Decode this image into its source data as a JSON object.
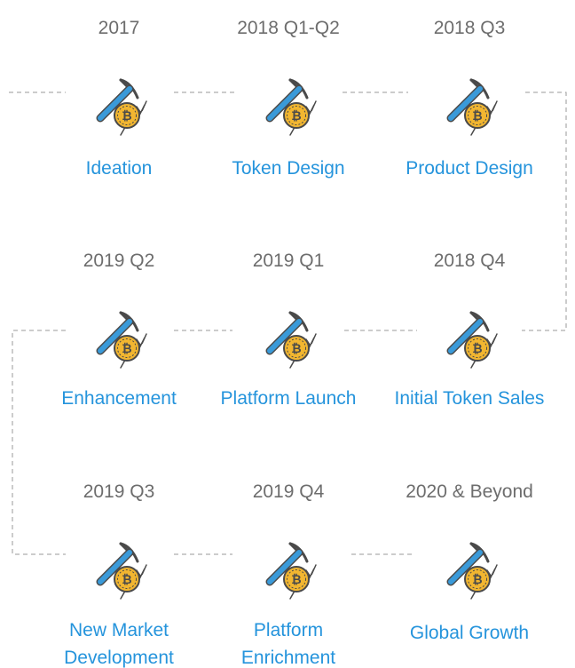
{
  "roadmap": {
    "milestones": [
      {
        "date": "2017",
        "label": "Ideation"
      },
      {
        "date": "2018 Q1-Q2",
        "label": "Token Design"
      },
      {
        "date": "2018 Q3",
        "label": "Product Design"
      },
      {
        "date": "2018 Q4",
        "label": "Initial Token Sales"
      },
      {
        "date": "2019 Q1",
        "label": "Platform Launch"
      },
      {
        "date": "2019 Q2",
        "label": "Enhancement"
      },
      {
        "date": "2019 Q3",
        "label": "New Market Development"
      },
      {
        "date": "2019 Q4",
        "label": "Platform Enrichment"
      },
      {
        "date": "2020 & Beyond",
        "label": "Global Growth"
      }
    ]
  },
  "icon": {
    "name": "pickaxe-bitcoin-icon",
    "glyph": "₿"
  },
  "colors": {
    "date_text": "#6d6d6d",
    "label_text": "#2594dc",
    "connector": "#9a9a9a",
    "pickaxe_handle": "#3a9ad9",
    "pickaxe_head": "#4a4a4a",
    "coin": "#f2b630"
  }
}
